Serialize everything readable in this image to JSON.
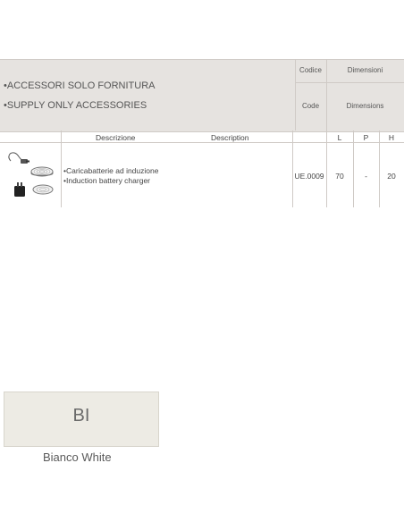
{
  "header": {
    "category_it": "•ACCESSORI SOLO FORNITURA",
    "category_en": "•SUPPLY ONLY ACCESSORIES",
    "code_it": "Codice",
    "code_en": "Code",
    "dimensions_it": "Dimensioni",
    "dimensions_en": "Dimensions"
  },
  "table": {
    "headers": {
      "description_it": "Descrizione",
      "description_en": "Description",
      "l": "L",
      "p": "P",
      "h": "H"
    },
    "rows": [
      {
        "image_icon": "induction-charger-icon",
        "description_it": "•Caricabatterie ad induzione",
        "description_en": "•Induction battery charger",
        "code": "UE.0009",
        "l": "70",
        "p": "-",
        "h": "20"
      }
    ]
  },
  "finish": {
    "code": "BI",
    "name": "Bianco White",
    "color": "#edebe4"
  }
}
